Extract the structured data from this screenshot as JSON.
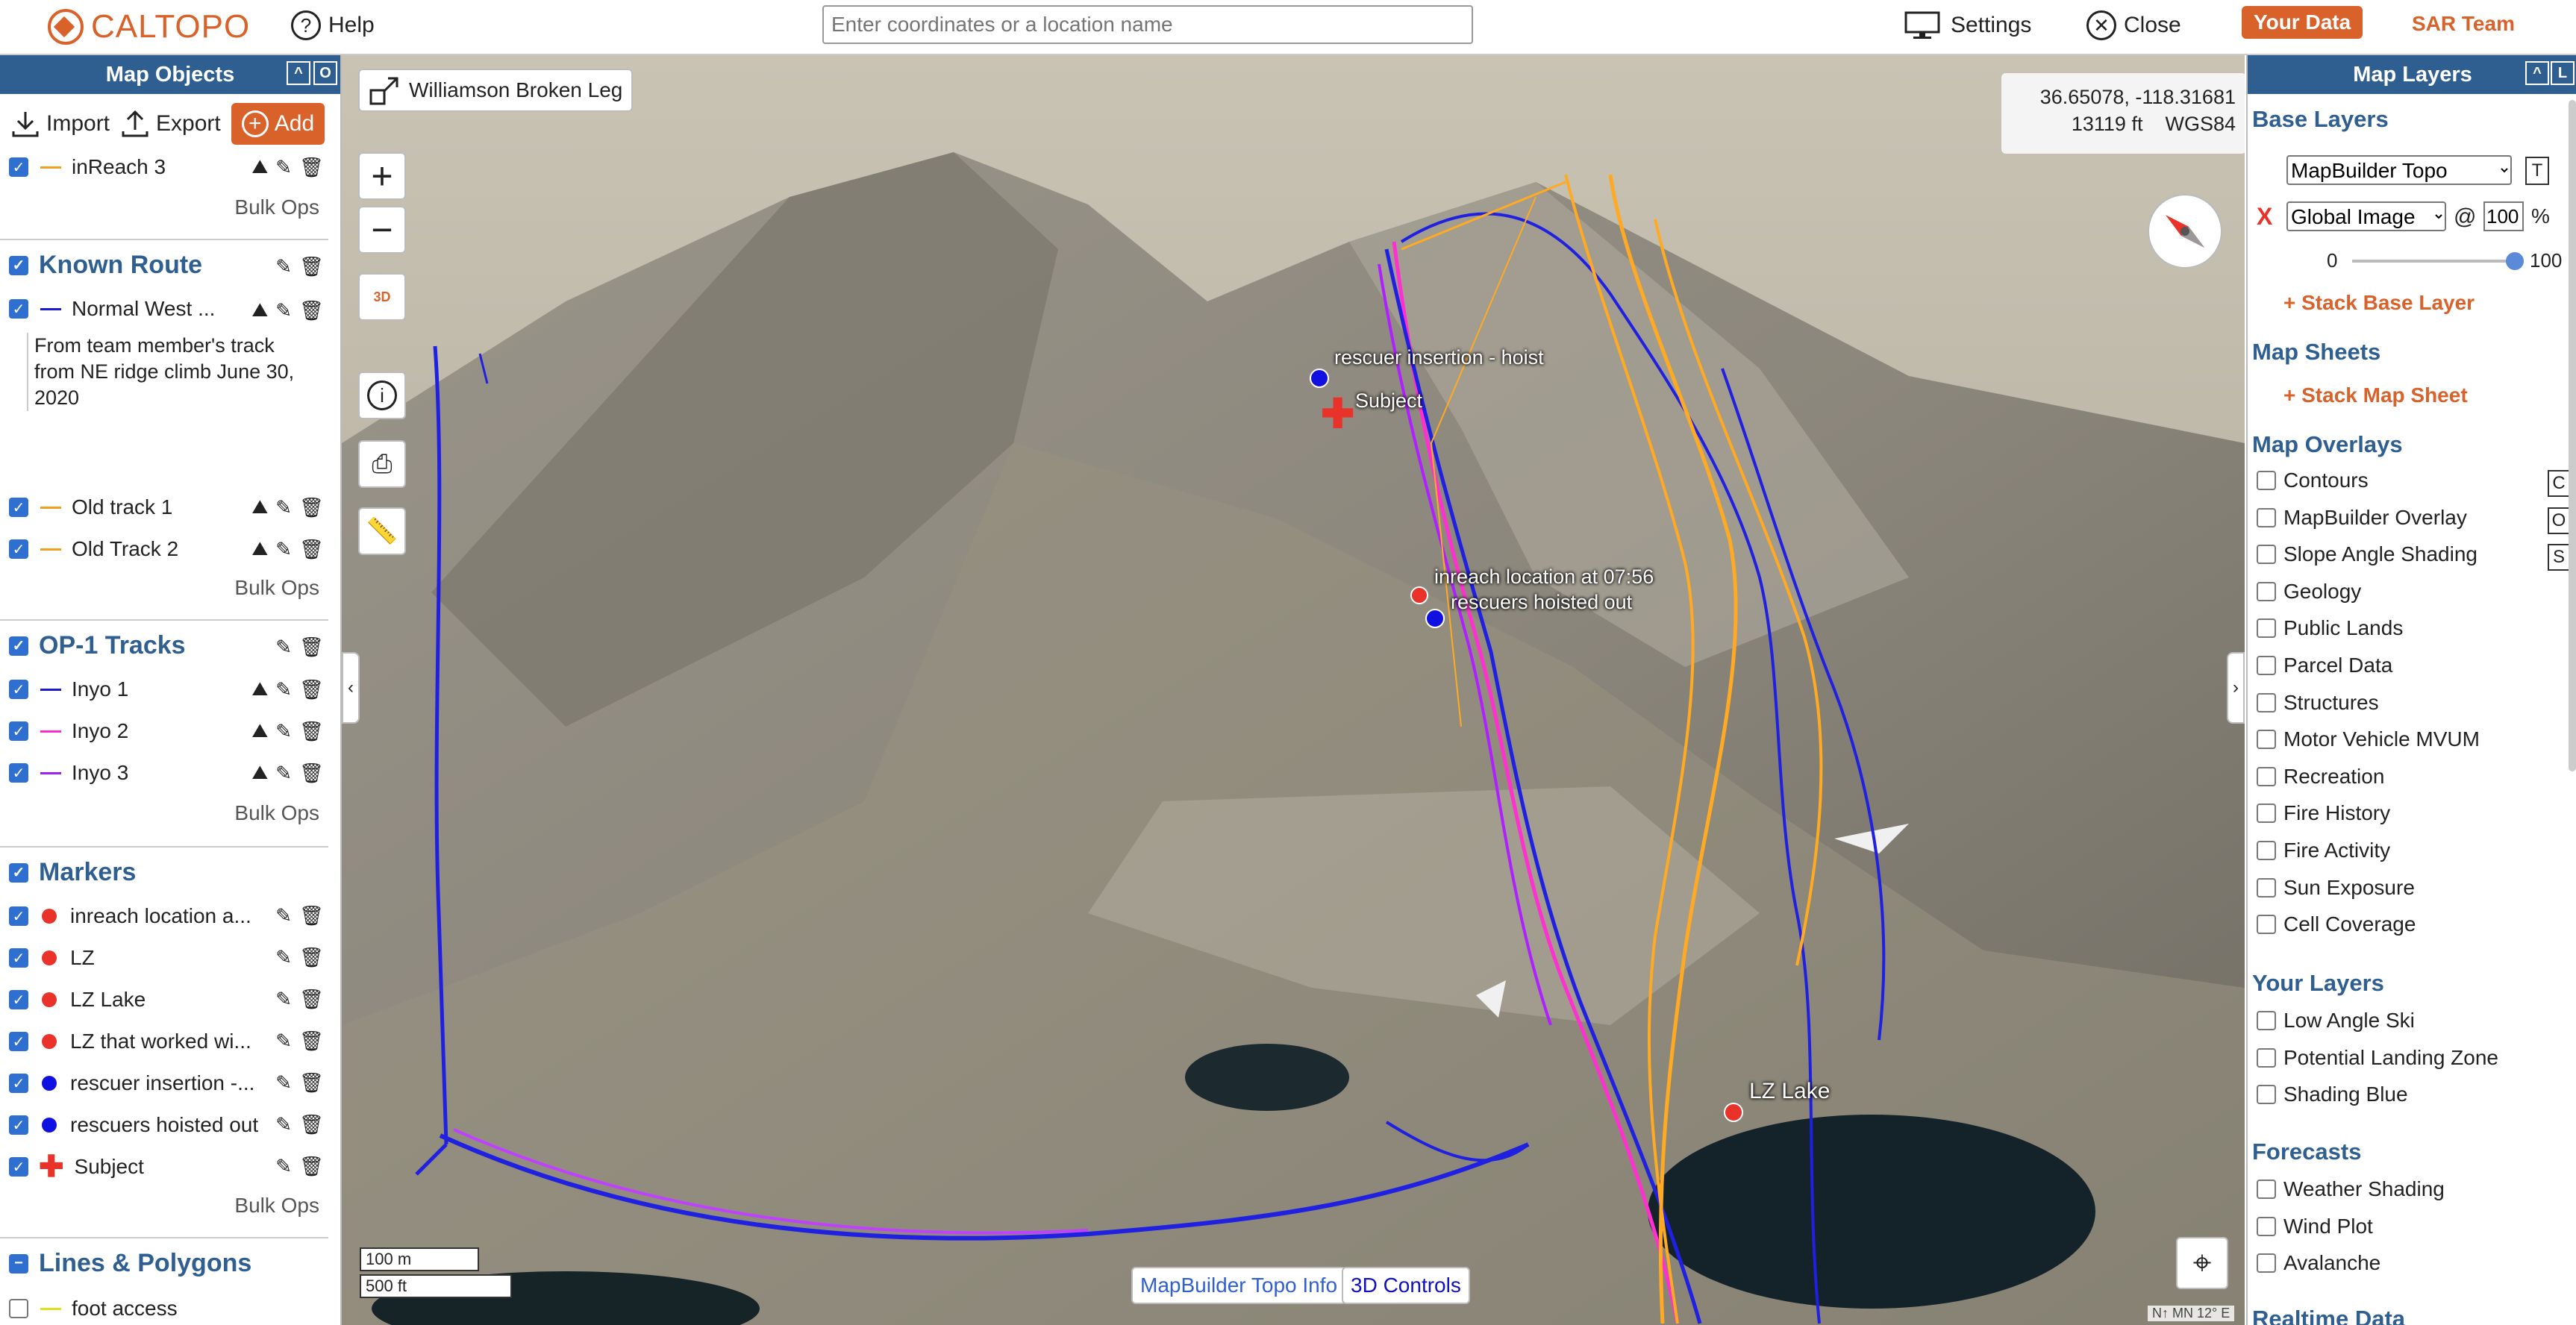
{
  "topbar": {
    "logo": "CALTOPO",
    "help": "Help",
    "search_placeholder": "Enter coordinates or a location name",
    "settings": "Settings",
    "close": "Close",
    "your_data": "Your Data",
    "sar_team": "SAR Team"
  },
  "left": {
    "title": "Map Objects",
    "import": "Import",
    "export": "Export",
    "add": "Add",
    "partial_item": "inReach 3",
    "bulk_ops": "Bulk Ops",
    "known_route": {
      "title": "Known Route",
      "items": [
        "Normal West ...",
        "Old track 1",
        "Old Track 2"
      ],
      "comment": "From team member's track from NE ridge climb June 30, 2020"
    },
    "op1": {
      "title": "OP-1 Tracks",
      "items": [
        "Inyo 1",
        "Inyo 2",
        "Inyo 3"
      ]
    },
    "markers": {
      "title": "Markers",
      "items": [
        "inreach location a...",
        "LZ",
        "LZ Lake",
        "LZ that worked wi...",
        "rescuer insertion -...",
        "rescuers hoisted out",
        "Subject"
      ]
    },
    "lines": {
      "title": "Lines & Polygons",
      "items": [
        "foot access"
      ]
    }
  },
  "map": {
    "title": "Williamson Broken Leg",
    "coords": "36.65078, -118.31681",
    "elevation": "13119 ft",
    "datum": "WGS84",
    "labels": {
      "rescuer_insertion": "rescuer insertion - hoist",
      "subject": "Subject",
      "inreach": "inreach location at 07:56",
      "hoisted": "rescuers hoisted out",
      "lz_lake": "LZ Lake"
    },
    "scale_m": "100 m",
    "scale_ft": "500 ft",
    "info_btn": "MapBuilder Topo Info",
    "controls_3d": "3D Controls",
    "three_d": "3D",
    "declination": "N↑ MN 12° E"
  },
  "right": {
    "title": "Map Layers",
    "base_layers": "Base Layers",
    "base_select": "MapBuilder Topo",
    "base_key": "T",
    "global_select": "Global Image",
    "opacity": "100",
    "pct": "%",
    "slider_min": "0",
    "slider_max": "100",
    "slider_value": 1.0,
    "stack_base": "+ Stack Base Layer",
    "map_sheets": "Map Sheets",
    "stack_sheet": "+ Stack Map Sheet",
    "map_overlays": "Map Overlays",
    "overlays": [
      "Contours",
      "MapBuilder Overlay",
      "Slope Angle Shading",
      "Geology",
      "Public Lands",
      "Parcel Data",
      "Structures",
      "Motor Vehicle MVUM",
      "Recreation",
      "Fire History",
      "Fire Activity",
      "Sun Exposure",
      "Cell Coverage"
    ],
    "overlay_keys": [
      "C",
      "O",
      "S"
    ],
    "your_layers": "Your Layers",
    "your_items": [
      "Low Angle Ski",
      "Potential Landing Zone",
      "Shading Blue"
    ],
    "forecasts": "Forecasts",
    "forecast_items": [
      "Weather Shading",
      "Wind Plot",
      "Avalanche"
    ],
    "realtime": "Realtime Data"
  }
}
